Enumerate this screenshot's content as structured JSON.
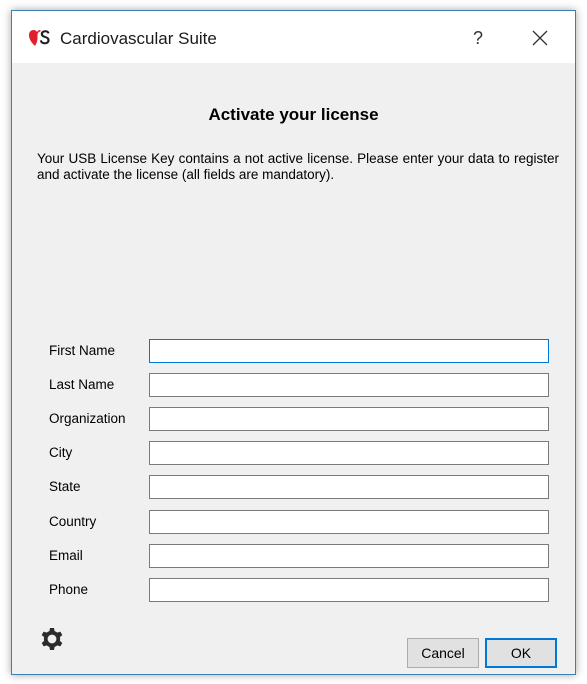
{
  "window": {
    "title": "Cardiovascular Suite"
  },
  "icons": {
    "logo": "heart-s-logo",
    "help": "question-mark-icon",
    "close": "close-icon",
    "settings": "gear-icon"
  },
  "titlebar": {
    "help_label": "?"
  },
  "dialog": {
    "heading": "Activate your license",
    "description": "Your USB License Key contains a not active license. Please enter your data to register and activate the license (all fields are mandatory).",
    "fields": [
      {
        "label": "First Name",
        "value": ""
      },
      {
        "label": "Last Name",
        "value": ""
      },
      {
        "label": "Organization",
        "value": ""
      },
      {
        "label": "City",
        "value": ""
      },
      {
        "label": "State",
        "value": ""
      },
      {
        "label": "Country",
        "value": ""
      },
      {
        "label": "Email",
        "value": ""
      },
      {
        "label": "Phone",
        "value": ""
      }
    ]
  },
  "buttons": {
    "cancel": "Cancel",
    "ok": "OK"
  },
  "colors": {
    "accent": "#0078d7",
    "logo_red": "#e0202c",
    "logo_dark": "#1e1e1e",
    "window_bg": "#f0f0f0"
  }
}
